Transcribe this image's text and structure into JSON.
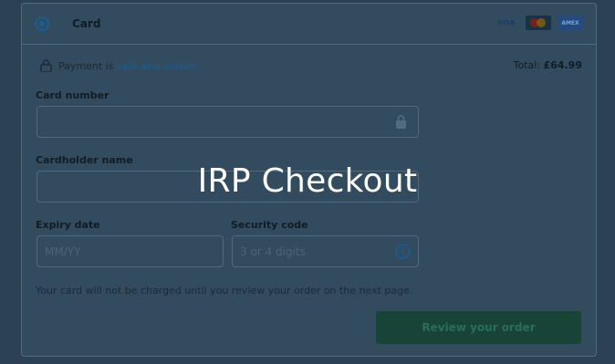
{
  "payment": {
    "method_label": "Card",
    "brands": [
      "VISA",
      "mastercard",
      "AMEX"
    ],
    "secure_prefix": "Payment is",
    "secure_link": "safe and secure",
    "total_label": "Total:",
    "total_value": "£64.99"
  },
  "form": {
    "card_number_label": "Card number",
    "card_number_value": "",
    "cardholder_label": "Cardholder name",
    "cardholder_value": "",
    "expiry_label": "Expiry date",
    "expiry_placeholder": "MM/YY",
    "security_label": "Security code",
    "security_placeholder": "3 or 4 digits"
  },
  "note": "Your card will not be charged until you review your order on the next page.",
  "review_button": "Review your order",
  "overlay_title": "IRP Checkout",
  "colors": {
    "accent": "#175f95",
    "button": "#174436"
  }
}
